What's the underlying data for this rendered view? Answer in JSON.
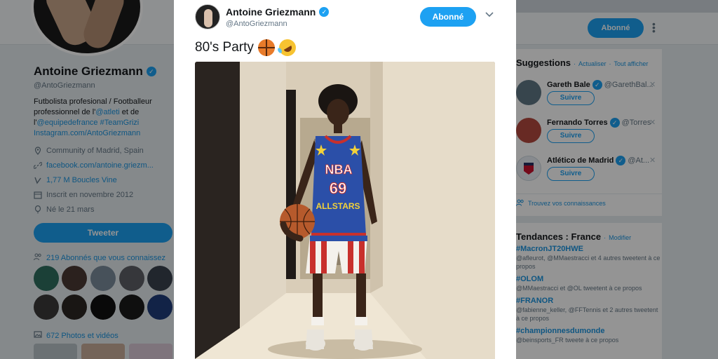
{
  "profile": {
    "name": "Antoine Griezmann",
    "handle": "@AntoGriezmann",
    "bio_line1": "Futbolista profesional / Footballeur",
    "bio_line2_a": "professionnel de l'",
    "bio_line2_link": "@atleti",
    "bio_line2_b": " et de",
    "bio_line3_a": "l'",
    "bio_line3_link1": "@equipedefrance",
    "bio_line3_link2": "#TeamGrizi",
    "bio_line4": "Instagram.com/AntoGriezmann",
    "location": "Community of Madrid, Spain",
    "website": "facebook.com/antoine.griezm...",
    "vine": "1,77 M Boucles Vine",
    "joined": "Inscrit en novembre 2012",
    "birthday": "Né le 21 mars",
    "tweet_button": "Tweeter",
    "followers_you_know": "219 Abonnés que vous connaissez",
    "photos_videos": "672 Photos et vidéos"
  },
  "header": {
    "follow_state": "Abonné"
  },
  "suggestions": {
    "title": "Suggestions",
    "refresh": "Actualiser",
    "show_all": "Tout afficher",
    "items": [
      {
        "name": "Gareth Bale",
        "handle": "@GarethBal...",
        "button": "Suivre"
      },
      {
        "name": "Fernando Torres",
        "handle": "@Torres",
        "button": "Suivre"
      },
      {
        "name": "Atlético de Madrid",
        "handle": "@At...",
        "button": "Suivre"
      }
    ],
    "find_friends": "Trouvez vos connaissances"
  },
  "trends": {
    "title": "Tendances : France",
    "modify": "Modifier",
    "items": [
      {
        "tag": "#MacronJT20HWE",
        "desc": "@afleurot, @MMaestracci et 4 autres tweetent à ce propos"
      },
      {
        "tag": "#OLOM",
        "desc": "@MMaestracci et @OL tweetent à ce propos"
      },
      {
        "tag": "#FRANOR",
        "desc": "@fabienne_keller, @FFTennis et 2 autres tweetent à ce propos"
      },
      {
        "tag": "#championnesdumonde",
        "desc": "@beinsports_FR tweete à ce propos"
      }
    ]
  },
  "modal": {
    "name": "Antoine Griezmann",
    "handle": "@AntoGriezmann",
    "follow_button": "Abonné",
    "text": "80's Party",
    "jersey_league": "NBA",
    "jersey_number": "69",
    "jersey_team": "ALLSTARS"
  },
  "colors": {
    "accent": "#1da1f2",
    "link": "#1b95e0",
    "muted": "#657786"
  }
}
